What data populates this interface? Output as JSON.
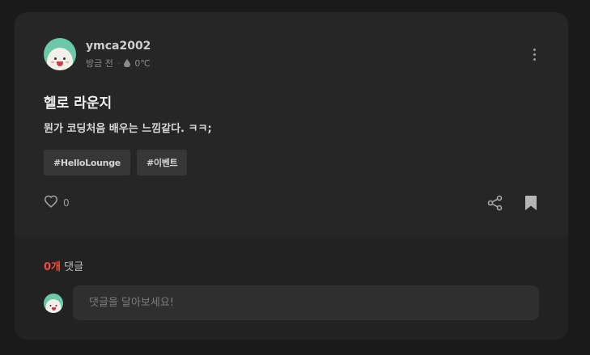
{
  "post": {
    "username": "ymca2002",
    "time": "방금 전",
    "temperature": "0℃",
    "title": "헬로 라운지",
    "body": "뭔가 코딩처음 배우는 느낌같다. ㅋㅋ;",
    "tags": [
      "#HelloLounge",
      "#이벤트"
    ],
    "like_count": "0",
    "icons": {
      "more": "more-vertical-icon",
      "drop": "water-drop-icon",
      "like": "heart-outline-icon",
      "share": "share-icon",
      "bookmark": "bookmark-icon"
    }
  },
  "comments": {
    "count": "0개",
    "label": "댓글",
    "placeholder": "댓글을 달아보세요!"
  },
  "colors": {
    "background": "#1a1a1a",
    "card": "#262626",
    "comment_section": "#222222",
    "accent": "#e8503a",
    "avatar": "#6cc8a8"
  }
}
